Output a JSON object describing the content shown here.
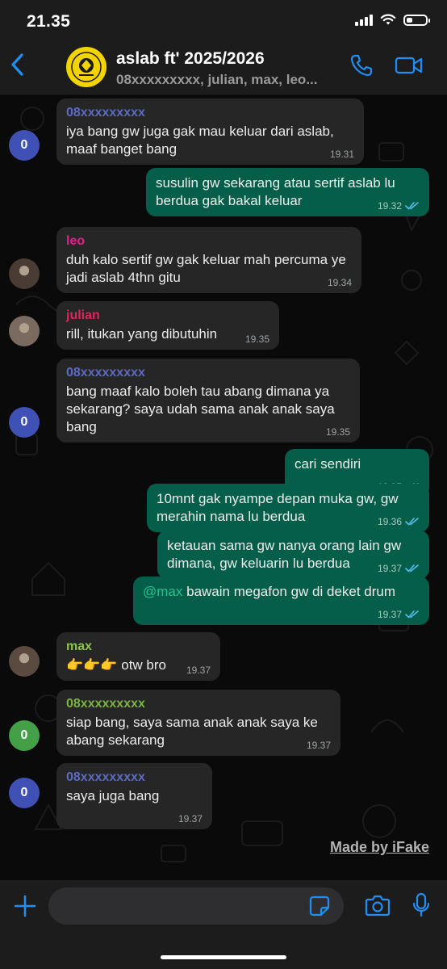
{
  "status_bar": {
    "time": "21.35",
    "battery_level": 0.3
  },
  "header": {
    "title": "aslab ft' 2025/2026",
    "subtitle": "08xxxxxxxxx, julian, max, leo...",
    "accent": "#1f8ff5"
  },
  "messages": [
    {
      "direction": "in",
      "sender": "08xxxxxxxxx",
      "sender_color": "#5c6bc0",
      "text": "iya bang gw juga gak mau keluar dari aslab, maaf banget bang",
      "time": "19.31",
      "avatar": "0",
      "avatar_color": "#3f51b5"
    },
    {
      "direction": "out",
      "text": "susulin gw sekarang atau sertif aslab lu berdua gak bakal keluar",
      "time": "19.32"
    },
    {
      "direction": "in",
      "sender": "leo",
      "sender_color": "#e91e8c",
      "text": "duh kalo sertif gw gak keluar mah percuma ye jadi aslab 4thn gitu",
      "time": "19.34",
      "avatar": "photo"
    },
    {
      "direction": "in",
      "sender": "julian",
      "sender_color": "#e0245e",
      "text": "rill, itukan yang dibutuhin",
      "time": "19.35",
      "avatar": "photo"
    },
    {
      "direction": "in",
      "sender": "08xxxxxxxxx",
      "sender_color": "#5c6bc0",
      "text": "bang maaf kalo boleh tau abang dimana ya sekarang? saya udah sama anak anak saya bang",
      "time": "19.35",
      "avatar": "0",
      "avatar_color": "#3f51b5"
    },
    {
      "direction": "out",
      "text": "cari sendiri",
      "time": "19.35"
    },
    {
      "direction": "out",
      "text": "10mnt gak nyampe depan muka gw, gw merahin nama lu berdua",
      "time": "19.36"
    },
    {
      "direction": "out",
      "text": "ketauan sama gw nanya orang lain gw dimana, gw keluarin lu berdua",
      "time": "19.37"
    },
    {
      "direction": "out",
      "mention": "@max",
      "text": "bawain megafon gw di deket drum",
      "time": "19.37"
    },
    {
      "direction": "in",
      "sender": "max",
      "sender_color": "#8bc34a",
      "text": "otw bro",
      "emoji": "👉👉👉",
      "time": "19.37",
      "avatar": "photo"
    },
    {
      "direction": "in",
      "sender": "08xxxxxxxxx",
      "sender_color": "#7cb342",
      "text": "siap bang, saya sama anak anak saya ke abang sekarang",
      "time": "19.37",
      "avatar": "0",
      "avatar_color": "#43a047"
    },
    {
      "direction": "in",
      "sender": "08xxxxxxxxx",
      "sender_color": "#5c6bc0",
      "text": "saya juga bang",
      "time": "19.37",
      "avatar": "0",
      "avatar_color": "#3f51b5"
    }
  ],
  "watermark": "Made by iFake",
  "input": {
    "placeholder": ""
  },
  "icons": [
    "back-chevron-icon",
    "phone-icon",
    "video-camera-icon",
    "plus-icon",
    "sticker-icon",
    "camera-icon",
    "microphone-icon"
  ]
}
